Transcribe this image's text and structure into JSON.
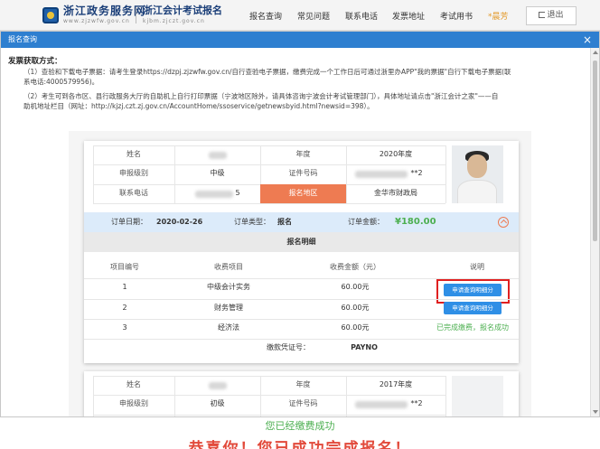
{
  "header": {
    "site1_title": "浙江政务服务网",
    "site1_url": "www.zjzwfw.gov.cn",
    "site2_title": "浙江会计考试报名",
    "site2_url": "kjbm.zjczt.gov.cn",
    "nav": [
      "报名查询",
      "常见问题",
      "联系电话",
      "发票地址",
      "考试用书",
      "*晨芳"
    ],
    "logout": "退出"
  },
  "modal": {
    "title": "报名查询",
    "close": "×",
    "invoice_title": "发票获取方式：",
    "invoice_p1a": "（1）查验和下载电子票据：请考生登录https://dzpj.zjzwfw.gov.cn/自行查验电子票据，缴费完成一个工作日后可通过浙里办APP\"我的票据\"自行下载电子票据(联",
    "invoice_p1b": "系电话:4000579956)。",
    "invoice_p2a": "（2）考生可到各市区、县行政服务大厅的自助机上自行打印票据（宁波地区除外，请具体咨询宁波会计考试管理部门），具体地址请点击\"浙江会计之家\"——自",
    "invoice_p2b": "助机地址栏目（网址：http://kjzj.czt.zj.gov.cn/AccountHome/ssoservice/getnewsbyid.html?newsid=398）。"
  },
  "record1": {
    "name_label": "姓名",
    "year_label": "年度",
    "year": "2020年度",
    "level_label": "申报级别",
    "level": "中级",
    "cert_label": "证件号码",
    "cert_tail": "**2",
    "phone_label": "联系电话",
    "phone_tail": "5",
    "area_label": "报名地区",
    "area": "金华市财政局",
    "order_date_label": "订单日期：",
    "order_date": "2020-02-26",
    "order_type_label": "订单类型：",
    "order_type": "报名",
    "order_amount_label": "订单金额：",
    "order_amount": "¥180.00",
    "detail_title": "报名明细",
    "cols": [
      "项目编号",
      "收费项目",
      "收费金额（元）",
      "说明"
    ],
    "rows": [
      {
        "no": "1",
        "item": "中级会计实务",
        "amount": "60.00元",
        "note": "申请查询明细分"
      },
      {
        "no": "2",
        "item": "财务管理",
        "amount": "60.00元",
        "note": "申请查询明细分"
      },
      {
        "no": "3",
        "item": "经济法",
        "amount": "60.00元",
        "note": "已完成缴费，报名成功"
      }
    ],
    "voucher_label": "缴款凭证号：",
    "voucher": "PAYNO"
  },
  "record2": {
    "name_label": "姓名",
    "year_label": "年度",
    "year": "2017年度",
    "level_label": "申报级别",
    "level": "初级",
    "cert_label": "证件号码",
    "cert_tail": "**2"
  },
  "below": {
    "paid": "您已经缴费成功",
    "congrats": "恭喜你！您已成功完成报名！"
  },
  "colors": {
    "modal_header": "#2e7fd0",
    "accent_orange": "#ee7b52",
    "price_green": "#4caf50",
    "button_blue": "#2f8fe6",
    "highlight_red": "#e02020"
  }
}
